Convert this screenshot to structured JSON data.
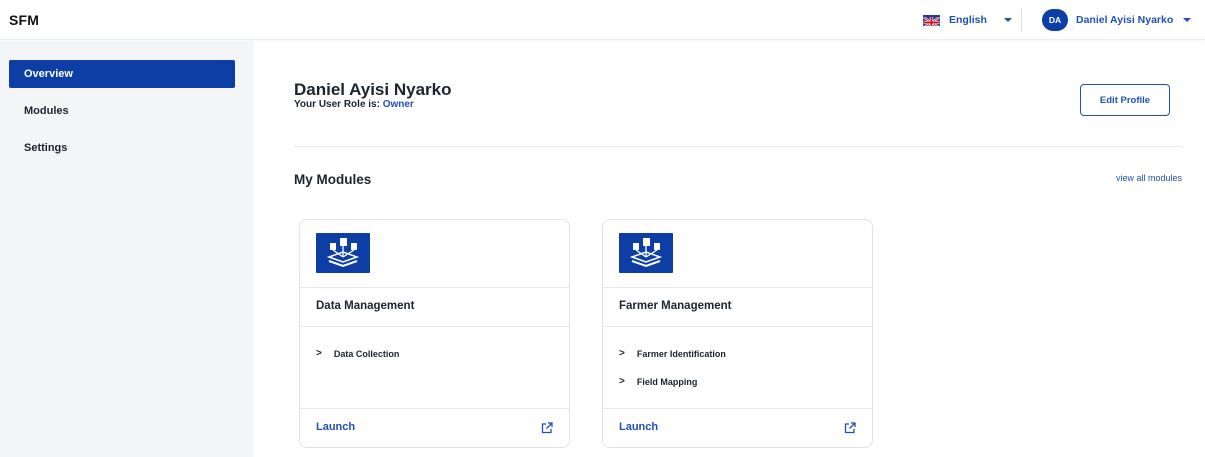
{
  "app": {
    "brand": "SFM"
  },
  "header": {
    "language": "English",
    "user_initials": "DA",
    "user_name": "Daniel Ayisi Nyarko"
  },
  "sidebar": {
    "items": [
      {
        "label": "Overview",
        "active": true
      },
      {
        "label": "Modules",
        "active": false
      },
      {
        "label": "Settings",
        "active": false
      }
    ]
  },
  "profile": {
    "name": "Daniel Ayisi Nyarko",
    "role_prefix": "Your User Role is: ",
    "role": "Owner",
    "edit_label": "Edit Profile"
  },
  "modules_section": {
    "title": "My Modules",
    "view_all": "view all modules"
  },
  "cards": [
    {
      "title": "Data Management",
      "features": [
        "Data Collection"
      ],
      "launch": "Launch"
    },
    {
      "title": "Farmer Management",
      "features": [
        "Farmer Identification",
        "Field Mapping"
      ],
      "launch": "Launch"
    }
  ],
  "colors": {
    "primary": "#0c3ea5",
    "link": "#1f4fb9",
    "sidebar_bg": "#f4f5f7"
  }
}
